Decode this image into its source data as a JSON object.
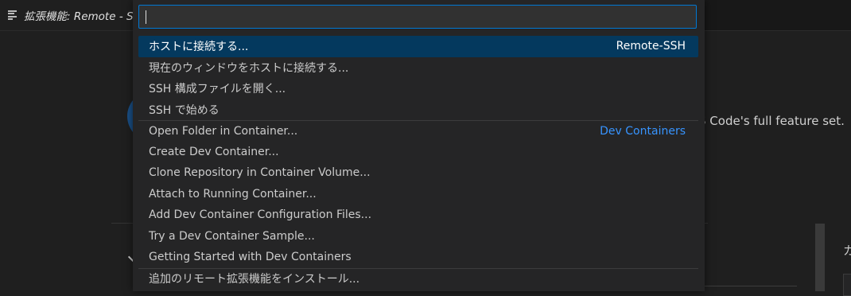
{
  "editor": {
    "tab_title": "拡張機能: Remote - S",
    "description_fragment": "S Code's full feature set.",
    "side_heading_fragment": "カ"
  },
  "quick_pick": {
    "input_value": "",
    "items": [
      {
        "label": "ホストに接続する...",
        "detail": "Remote-SSH",
        "selected": true
      },
      {
        "label": "現在のウィンドウをホストに接続する..."
      },
      {
        "label": "SSH 構成ファイルを開く..."
      },
      {
        "label": "SSH で始める"
      },
      {
        "label": "Open Folder in Container...",
        "detail": "Dev Containers"
      },
      {
        "label": "Create Dev Container..."
      },
      {
        "label": "Clone Repository in Container Volume..."
      },
      {
        "label": "Attach to Running Container..."
      },
      {
        "label": "Add Dev Container Configuration Files..."
      },
      {
        "label": "Try a Dev Container Sample..."
      },
      {
        "label": "Getting Started with Dev Containers"
      },
      {
        "label": "追加のリモート拡張機能をインストール..."
      }
    ]
  },
  "colors": {
    "accent_focus": "#0078d4",
    "selection_bg": "#04395e",
    "group_label": "#3794ff"
  },
  "icons": {
    "tab": "preview-lines-icon",
    "chevron": "chevron-down-icon"
  }
}
